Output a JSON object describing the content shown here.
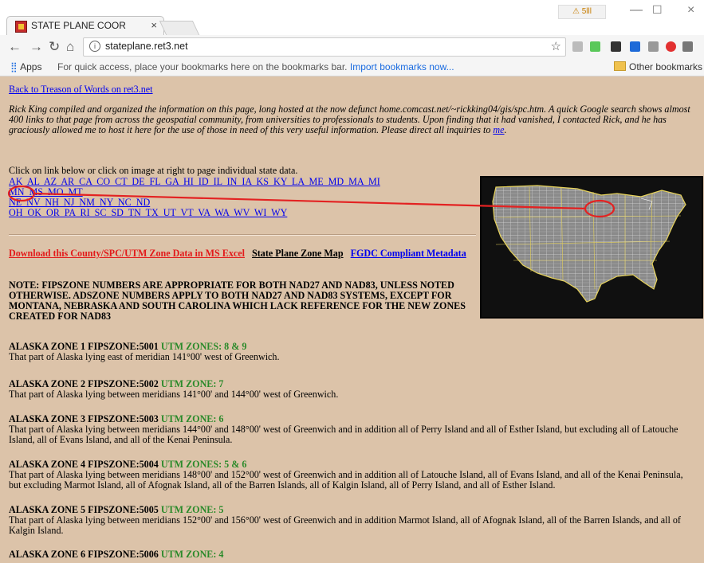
{
  "browser": {
    "tab_title": "STATE PLANE COOR",
    "tab_close": "×",
    "warning_badge": "⚠ 5lll",
    "url": "stateplane.ret3.net",
    "bookmarks": {
      "apps_label": "Apps",
      "hint_text": "For quick access, place your bookmarks here on the bookmarks bar.",
      "import_link": "Import bookmarks now...",
      "other_label": "Other bookmarks"
    }
  },
  "page": {
    "back_link": "Back to Treason of Words on ret3.net",
    "intro_text": "Rick King compiled and organized the information on this page, long hosted at the now defunct home.comcast.net/~rickking04/gis/spc.htm. A quick Google search shows almost 400 links to that page from across the geospatial community, from universities to professionals to students. Upon finding that it had vanished, I contacted Rick, and he has graciously allowed me to host it here for the use of those in need of this very useful information. Please direct all inquiries to",
    "intro_link": "me",
    "intro_end": ".",
    "click_text": "Click on link below or click on image at right to page individual state data.",
    "states_line1": "AK AL AZ AR CA CO CT DE FL GA HI ID IL IN IA KS KY LA ME MD MA MI",
    "states_line2": "MN MS MO MT",
    "states_line3": "NE NV NH NJ NM NY NC ND",
    "states_line4": "OH OK OR PA RI SC SD TN TX UT VT VA WA WV WI WY",
    "download_link": "Download this County/SPC/UTM Zone Data in MS Excel",
    "zone_map_link": "State Plane Zone Map",
    "fgdc_link": "FGDC Compliant Metadata",
    "note": "NOTE: FIPSZONE NUMBERS ARE APPROPRIATE FOR BOTH NAD27 AND NAD83, UNLESS NOTED OTHERWISE. ADSZONE NUMBERS APPLY TO BOTH NAD27 AND NAD83 SYSTEMS, EXCEPT FOR MONTANA, NEBRASKA AND SOUTH CAROLINA WHICH LACK REFERENCE FOR THE NEW ZONES CREATED FOR NAD83",
    "zones": [
      {
        "heading": "ALASKA ZONE 1 FIPSZONE:5001",
        "utm": "UTM ZONES: 8 & 9",
        "text": "That part of Alaska lying east of meridian 141°00' west of Greenwich."
      },
      {
        "heading": "ALASKA ZONE 2 FIPSZONE:5002",
        "utm": "UTM ZONE: 7",
        "text": "That part of Alaska lying between meridians 141°00' and 144°00' west of Greenwich."
      },
      {
        "heading": "ALASKA ZONE 3 FIPSZONE:5003",
        "utm": "UTM ZONE: 6",
        "text": "That part of Alaska lying between meridians 144°00' and 148°00' west of Greenwich and in addition all of Perry Island and all of Esther Island, but excluding all of Latouche Island, all of Evans Island, and all of the Kenai Peninsula."
      },
      {
        "heading": "ALASKA ZONE 4 FIPSZONE:5004",
        "utm": "UTM ZONES: 5 & 6",
        "text": "That part of Alaska lying between meridians 148°00' and 152°00' west of Greenwich and in addition all of Latouche Island, all of Evans Island, and all of the Kenai Peninsula, but excluding Marmot Island, all of Afognak Island, all of the Barren Islands, all of Kalgin Island, all of Perry Island, and all of Esther Island."
      },
      {
        "heading": "ALASKA ZONE 5 FIPSZONE:5005",
        "utm": "UTM ZONE: 5",
        "text": "That part of Alaska lying between meridians 152°00' and 156°00' west of Greenwich and in addition Marmot Island, all of Afognak Island, all of the Barren Islands, and all of Kalgin Island."
      },
      {
        "heading": "ALASKA ZONE 6 FIPSZONE:5006",
        "utm": "UTM ZONE: 4",
        "text": ""
      }
    ]
  }
}
